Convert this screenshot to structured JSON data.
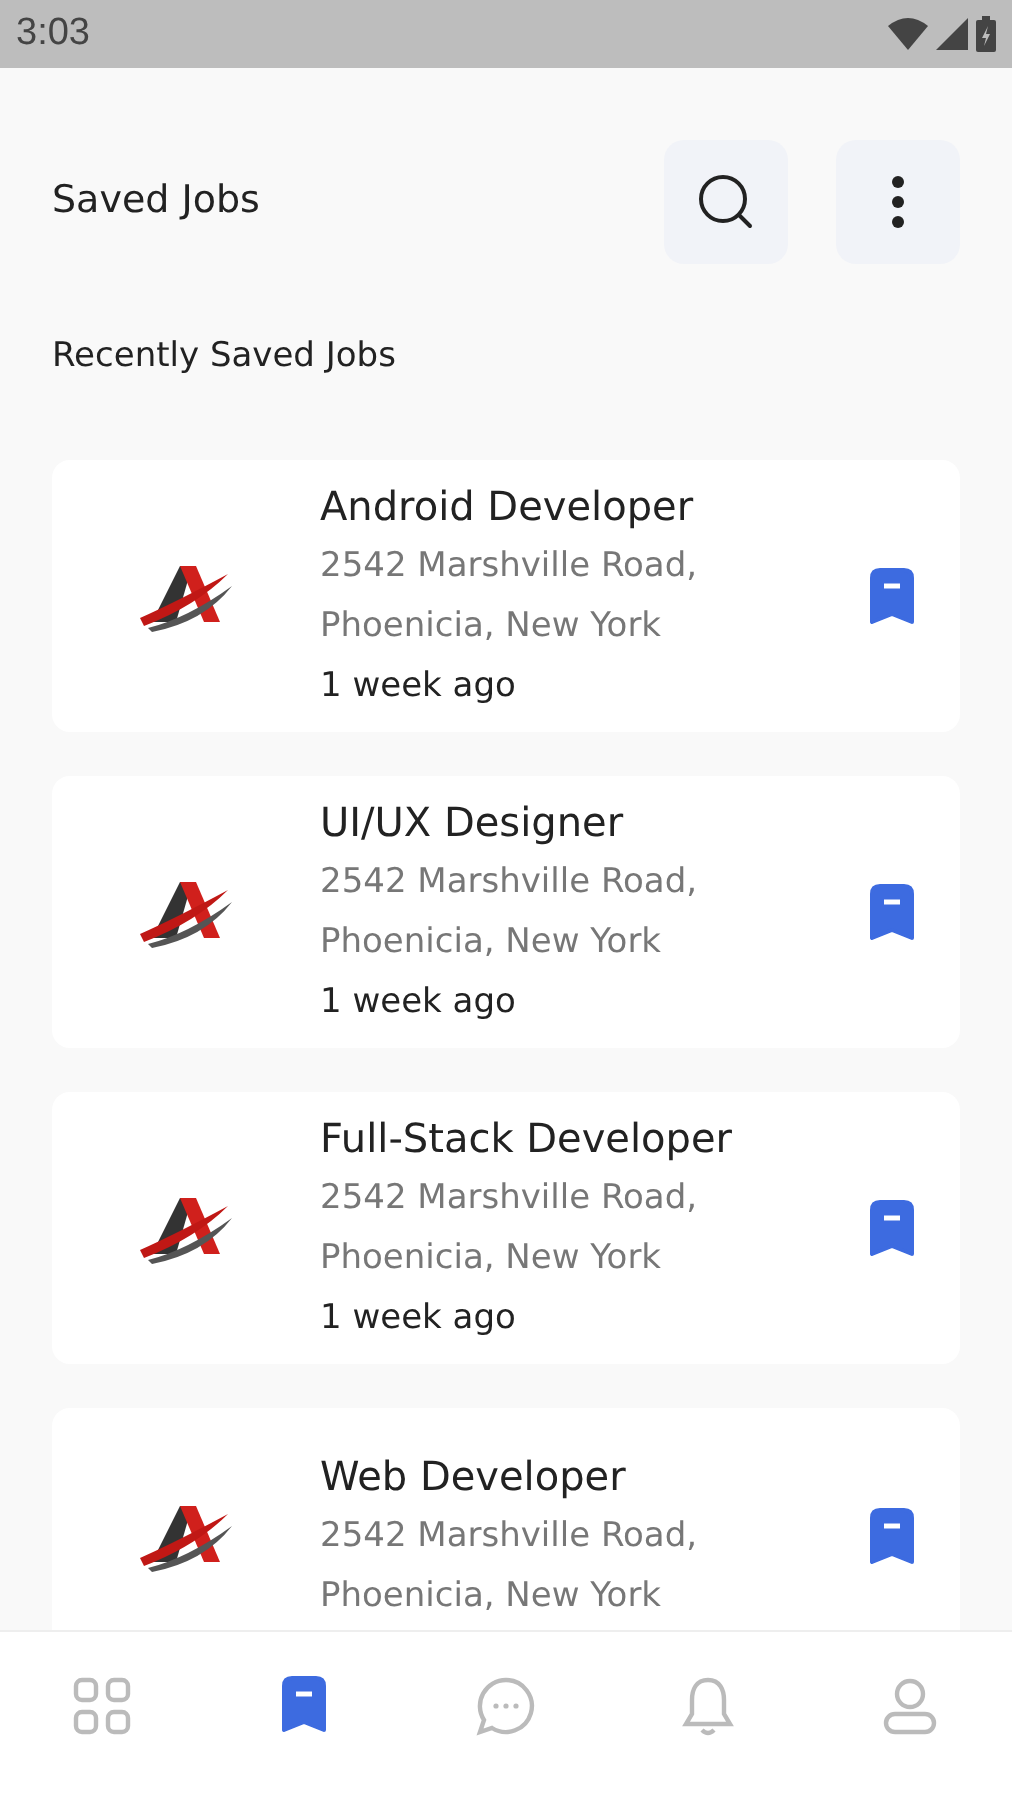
{
  "status_bar": {
    "time": "3:03"
  },
  "header": {
    "title": "Saved Jobs"
  },
  "section_title": "Recently Saved Jobs",
  "jobs": [
    {
      "title": "Android Developer",
      "address": "2542 Marshville Road, Phoenicia, New York",
      "posted": "1 week ago",
      "saved": true
    },
    {
      "title": "UI/UX Designer",
      "address": "2542 Marshville Road, Phoenicia, New York",
      "posted": "1 week ago",
      "saved": true
    },
    {
      "title": "Full-Stack Developer",
      "address": "2542 Marshville Road, Phoenicia, New York",
      "posted": "1 week ago",
      "saved": true
    },
    {
      "title": "Web Developer",
      "address": "2542 Marshville Road, Phoenicia, New York",
      "saved": true
    }
  ],
  "bottom_nav": [
    {
      "kind": "grid",
      "selected": false
    },
    {
      "kind": "bookmark",
      "selected": true
    },
    {
      "kind": "chat",
      "selected": false
    },
    {
      "kind": "bell",
      "selected": false
    },
    {
      "kind": "profile",
      "selected": false
    }
  ]
}
